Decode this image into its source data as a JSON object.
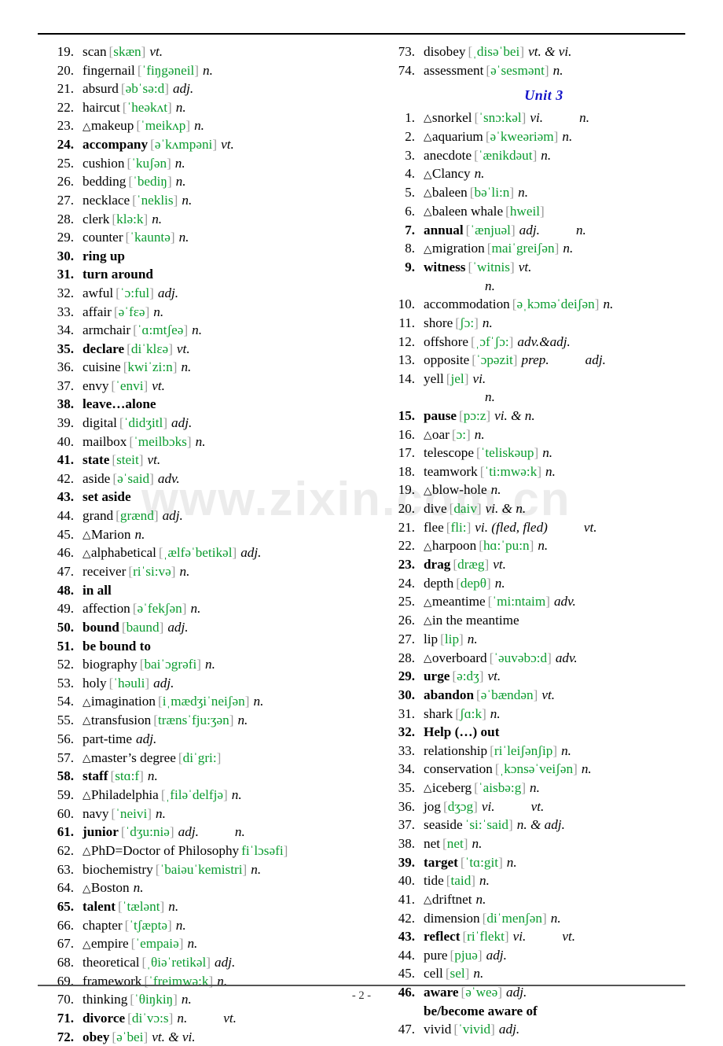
{
  "page": {
    "footer": "- 2 -",
    "watermark": "www.zixin.com.cn",
    "accent_green": "#0c9c30",
    "bracket_gray": "#9a9a9a",
    "unit_blue": "#1414c8"
  },
  "left_column": {
    "entries": [
      {
        "num": "19.",
        "word": "scan",
        "phon": "[skæn]",
        "pos": "vt.",
        "bold": false,
        "tri": false
      },
      {
        "num": "20.",
        "word": "fingernail",
        "phon": "[ˈfiŋgəneil]",
        "pos": "n.",
        "bold": false,
        "tri": false
      },
      {
        "num": "21.",
        "word": "absurd",
        "phon": "[əbˈsə:d]",
        "pos": "adj.",
        "bold": false,
        "tri": false
      },
      {
        "num": "22.",
        "word": "haircut",
        "phon": "[ˈheəkʌt]",
        "pos": "n.",
        "bold": false,
        "tri": false
      },
      {
        "num": "23.",
        "word": "makeup",
        "phon": "[ˈmeikʌp]",
        "pos": "n.",
        "bold": false,
        "tri": true
      },
      {
        "num": "24.",
        "word": "accompany",
        "phon": "[əˈkʌmpəni]",
        "pos": "vt.",
        "bold": true,
        "tri": false
      },
      {
        "num": "25.",
        "word": "cushion",
        "phon": "[ˈkuʃən]",
        "pos": "n.",
        "bold": false,
        "tri": false
      },
      {
        "num": "26.",
        "word": "bedding",
        "phon": "[ˈbediŋ]",
        "pos": "n.",
        "bold": false,
        "tri": false
      },
      {
        "num": "27.",
        "word": "necklace",
        "phon": "[ˈneklis]",
        "pos": "n.",
        "bold": false,
        "tri": false
      },
      {
        "num": "28.",
        "word": "clerk",
        "phon": "[klə:k]",
        "pos": "n.",
        "bold": false,
        "tri": false
      },
      {
        "num": "29.",
        "word": "counter",
        "phon": "[ˈkauntə]",
        "pos": "n.",
        "bold": false,
        "tri": false
      },
      {
        "num": "30.",
        "word": "ring up",
        "phon": "",
        "pos": "",
        "bold": true,
        "tri": false
      },
      {
        "num": "31.",
        "word": "turn around",
        "phon": "",
        "pos": "",
        "bold": true,
        "tri": false
      },
      {
        "num": "32.",
        "word": "awful",
        "phon": "[ˈɔ:ful]",
        "pos": "adj.",
        "bold": false,
        "tri": false
      },
      {
        "num": "33.",
        "word": "affair",
        "phon": "[əˈfɛə]",
        "pos": "n.",
        "bold": false,
        "tri": false
      },
      {
        "num": "34.",
        "word": "armchair",
        "phon": "[ˈɑ:mtʃeə]",
        "pos": "n.",
        "bold": false,
        "tri": false
      },
      {
        "num": "35.",
        "word": "declare",
        "phon": "[diˈklɛə]",
        "pos": "vt.",
        "bold": true,
        "tri": false
      },
      {
        "num": "36.",
        "word": "cuisine",
        "phon": "[kwiˈzi:n]",
        "pos": "n.",
        "bold": false,
        "tri": false
      },
      {
        "num": "37.",
        "word": "envy",
        "phon": "[ˈenvi]",
        "pos": "vt.",
        "bold": false,
        "tri": false
      },
      {
        "num": "38.",
        "word": "leave…alone",
        "phon": "",
        "pos": "",
        "bold": true,
        "tri": false
      },
      {
        "num": "39.",
        "word": "digital",
        "phon": "[ˈdidʒitl]",
        "pos": "adj.",
        "bold": false,
        "tri": false
      },
      {
        "num": "40.",
        "word": "mailbox",
        "phon": "[ˈmeilbɔks]",
        "pos": "n.",
        "bold": false,
        "tri": false
      },
      {
        "num": "41.",
        "word": "state",
        "phon": "[steit]",
        "pos": "vt.",
        "bold": true,
        "tri": false
      },
      {
        "num": "42.",
        "word": "aside",
        "phon": "[əˈsaid]",
        "pos": "adv.",
        "bold": false,
        "tri": false
      },
      {
        "num": "43.",
        "word": "set aside",
        "phon": "",
        "pos": "",
        "bold": true,
        "tri": false
      },
      {
        "num": "44.",
        "word": "grand",
        "phon": "[grænd]",
        "pos": "adj.",
        "bold": false,
        "tri": false
      },
      {
        "num": "45.",
        "word": "Marion",
        "phon": "",
        "pos": "n.",
        "bold": false,
        "tri": true
      },
      {
        "num": "46.",
        "word": "alphabetical",
        "phon": "[ˌælfəˈbetikəl]",
        "pos": "adj.",
        "bold": false,
        "tri": true
      },
      {
        "num": "47.",
        "word": "receiver",
        "phon": "[riˈsi:və]",
        "pos": "n.",
        "bold": false,
        "tri": false
      },
      {
        "num": "48.",
        "word": "in all",
        "phon": "",
        "pos": "",
        "bold": true,
        "tri": false
      },
      {
        "num": "49.",
        "word": "affection",
        "phon": "[əˈfekʃən]",
        "pos": "n.",
        "bold": false,
        "tri": false
      },
      {
        "num": "50.",
        "word": "bound",
        "phon": "[baund]",
        "pos": "adj.",
        "bold": true,
        "tri": false
      },
      {
        "num": "51.",
        "word": "be bound to",
        "phon": "",
        "pos": "",
        "bold": true,
        "tri": false
      },
      {
        "num": "52.",
        "word": "biography",
        "phon": "[baiˈɔgrəfi]",
        "pos": "n.",
        "bold": false,
        "tri": false
      },
      {
        "num": "53.",
        "word": "holy",
        "phon": "[ˈhəuli]",
        "pos": "adj.",
        "bold": false,
        "tri": false
      },
      {
        "num": "54.",
        "word": "imagination",
        "phon": "[iˌmædʒiˈneiʃən]",
        "pos": "n.",
        "bold": false,
        "tri": true
      },
      {
        "num": "55.",
        "word": "transfusion",
        "phon": "[trænsˈfju:ʒən]",
        "pos": "n.",
        "bold": false,
        "tri": true
      },
      {
        "num": "56.",
        "word": "part-time",
        "phon": "",
        "pos": "adj.",
        "bold": false,
        "tri": false
      },
      {
        "num": "57.",
        "word": "master’s degree",
        "phon": "[diˈgri:]",
        "pos": "",
        "bold": false,
        "tri": true
      },
      {
        "num": "58.",
        "word": "staff",
        "phon": "[stɑ:f]",
        "pos": "n.",
        "bold": true,
        "tri": false
      },
      {
        "num": "59.",
        "word": "Philadelphia",
        "phon": "[ˌfiləˈdelfjə]",
        "pos": "n.",
        "bold": false,
        "tri": true
      },
      {
        "num": "60.",
        "word": "navy",
        "phon": "[ˈneivi]",
        "pos": "n.",
        "bold": false,
        "tri": false
      },
      {
        "num": "61.",
        "word": "junior",
        "phon": "[ˈdʒu:niə]",
        "pos": "adj.",
        "pos2": "n.",
        "bold": true,
        "tri": false
      },
      {
        "num": "62.",
        "word": "PhD=Doctor of Philosophy",
        "phon": "fiˈlɔsəfi]",
        "pos": "",
        "bold": false,
        "tri": true
      },
      {
        "num": "63.",
        "word": "biochemistry",
        "phon": "[ˈbaiəuˈkemistri]",
        "pos": "n.",
        "bold": false,
        "tri": false
      },
      {
        "num": "64.",
        "word": "Boston",
        "phon": "",
        "pos": "n.",
        "bold": false,
        "tri": true
      },
      {
        "num": "65.",
        "word": "talent",
        "phon": "[ˈtælənt]",
        "pos": "n.",
        "bold": true,
        "tri": false
      },
      {
        "num": "66.",
        "word": "chapter",
        "phon": "[ˈtʃæptə]",
        "pos": "n.",
        "bold": false,
        "tri": false
      },
      {
        "num": "67.",
        "word": "empire",
        "phon": "[ˈempaiə]",
        "pos": "n.",
        "bold": false,
        "tri": true
      },
      {
        "num": "68.",
        "word": "theoretical",
        "phon": "[ˌθiəˈretikəl]",
        "pos": "adj.",
        "bold": false,
        "tri": false
      },
      {
        "num": "69.",
        "word": "framework",
        "phon": "[ˈfreimwə:k]",
        "pos": "n.",
        "bold": false,
        "tri": false
      },
      {
        "num": "70.",
        "word": "thinking",
        "phon": "[ˈθiŋkiŋ]",
        "pos": "n.",
        "bold": false,
        "tri": false
      },
      {
        "num": "71.",
        "word": "divorce",
        "phon": "[diˈvɔ:s]",
        "pos": "n.",
        "pos2": "vt.",
        "bold": true,
        "tri": false
      },
      {
        "num": "72.",
        "word": "obey",
        "phon": "[əˈbei]",
        "pos": "vt. & vi.",
        "bold": true,
        "tri": false
      }
    ]
  },
  "right_column": {
    "pre_entries": [
      {
        "num": "73.",
        "word": "disobey",
        "phon": "[ˌdisəˈbei]",
        "pos": "vt. & vi.",
        "bold": false,
        "tri": false
      },
      {
        "num": "74.",
        "word": "assessment",
        "phon": "[əˈsesmənt]",
        "pos": "n.",
        "bold": false,
        "tri": false
      }
    ],
    "unit_heading": "Unit 3",
    "entries": [
      {
        "num": "1.",
        "word": "snorkel",
        "phon": "[ˈsnɔ:kəl]",
        "pos": "vi.",
        "pos2": "n.",
        "bold": false,
        "tri": true
      },
      {
        "num": "2.",
        "word": "aquarium",
        "phon": "[əˈkweəriəm]",
        "pos": "n.",
        "bold": false,
        "tri": true
      },
      {
        "num": "3.",
        "word": "anecdote",
        "phon": "[ˈænikdəut]",
        "pos": "n.",
        "bold": false,
        "tri": false
      },
      {
        "num": "4.",
        "word": "Clancy",
        "phon": "",
        "pos": "n.",
        "bold": false,
        "tri": true
      },
      {
        "num": "5.",
        "word": "baleen",
        "phon": "[bəˈli:n]",
        "pos": "n.",
        "bold": false,
        "tri": true
      },
      {
        "num": "6.",
        "word": "baleen whale",
        "phon": "[hweil]",
        "pos": "",
        "bold": false,
        "tri": true
      },
      {
        "num": "7.",
        "word": "annual",
        "phon": "[ˈænjuəl]",
        "pos": "adj.",
        "pos2": "n.",
        "bold": true,
        "tri": false
      },
      {
        "num": "8.",
        "word": "migration",
        "phon": "[maiˈgreiʃən]",
        "pos": "n.",
        "bold": false,
        "tri": true
      },
      {
        "num": "9.",
        "word": "witness",
        "phon": "[ˈwitnis]",
        "pos": "vt.",
        "bold": true,
        "tri": false,
        "cont": "n."
      },
      {
        "num": "10.",
        "word": "accommodation",
        "phon": "[əˌkɔməˈdeiʃən]",
        "pos": "n.",
        "bold": false,
        "tri": false
      },
      {
        "num": "11.",
        "word": "shore",
        "phon": "[ʃɔ:]",
        "pos": "n.",
        "bold": false,
        "tri": false
      },
      {
        "num": "12.",
        "word": "offshore",
        "phon": "[ˌɔfˈʃɔ:]",
        "pos": "adv.&adj.",
        "bold": false,
        "tri": false
      },
      {
        "num": "13.",
        "word": "opposite",
        "phon": "[ˈɔpəzit]",
        "pos": "prep.",
        "pos2": "adj.",
        "bold": false,
        "tri": false
      },
      {
        "num": "14.",
        "word": "yell",
        "phon": "[jel]",
        "pos": "vi.",
        "bold": false,
        "tri": false,
        "cont": "n."
      },
      {
        "num": "15.",
        "word": "pause",
        "phon": "[pɔ:z]",
        "pos": "vi. & n.",
        "bold": true,
        "tri": false
      },
      {
        "num": "16.",
        "word": "oar",
        "phon": "[ɔ:]",
        "pos": "n.",
        "bold": false,
        "tri": true
      },
      {
        "num": "17.",
        "word": "telescope",
        "phon": "[ˈteliskəup]",
        "pos": "n.",
        "bold": false,
        "tri": false
      },
      {
        "num": "18.",
        "word": "teamwork",
        "phon": "[ˈti:mwə:k]",
        "pos": "n.",
        "bold": false,
        "tri": false
      },
      {
        "num": "19.",
        "word": "blow-hole",
        "phon": "",
        "pos": "n.",
        "bold": false,
        "tri": true
      },
      {
        "num": "20.",
        "word": "dive",
        "phon": "[daiv]",
        "pos": "vi. & n.",
        "bold": false,
        "tri": false
      },
      {
        "num": "21.",
        "word": "flee",
        "phon": "[fli:]",
        "pos": "vi. (fled, fled)",
        "pos2": "vt.",
        "bold": false,
        "tri": false
      },
      {
        "num": "22.",
        "word": "harpoon",
        "phon": "[hɑ:ˈpu:n]",
        "pos": "n.",
        "bold": false,
        "tri": true
      },
      {
        "num": "23.",
        "word": "drag",
        "phon": "[dræg]",
        "pos": "vt.",
        "bold": true,
        "tri": false
      },
      {
        "num": "24.",
        "word": "depth",
        "phon": "[depθ]",
        "pos": "n.",
        "bold": false,
        "tri": false
      },
      {
        "num": "25.",
        "word": "meantime",
        "phon": "[ˈmi:ntaim]",
        "pos": "adv.",
        "bold": false,
        "tri": true
      },
      {
        "num": "26.",
        "word": "in the meantime",
        "phon": "",
        "pos": "",
        "bold": false,
        "tri": true
      },
      {
        "num": "27.",
        "word": "lip",
        "phon": "[lip]",
        "pos": "n.",
        "bold": false,
        "tri": false
      },
      {
        "num": "28.",
        "word": "overboard",
        "phon": "[ˈəuvəbɔ:d]",
        "pos": "adv.",
        "bold": false,
        "tri": true
      },
      {
        "num": "29.",
        "word": "urge",
        "phon": "[ə:dʒ]",
        "pos": "vt.",
        "bold": true,
        "tri": false
      },
      {
        "num": "30.",
        "word": "abandon",
        "phon": "[əˈbændən]",
        "pos": "vt.",
        "bold": true,
        "tri": false
      },
      {
        "num": "31.",
        "word": "shark",
        "phon": "[ʃɑ:k]",
        "pos": "n.",
        "bold": false,
        "tri": false
      },
      {
        "num": "32.",
        "word": "Help (…) out",
        "phon": "",
        "pos": "",
        "bold": true,
        "tri": false
      },
      {
        "num": "33.",
        "word": "relationship",
        "phon": "[riˈleiʃənʃip]",
        "pos": "n.",
        "bold": false,
        "tri": false
      },
      {
        "num": "34.",
        "word": "conservation",
        "phon": "[ˌkɔnsəˈveiʃən]",
        "pos": "n.",
        "bold": false,
        "tri": false
      },
      {
        "num": "35.",
        "word": "iceberg",
        "phon": "[ˈaisbə:g]",
        "pos": "n.",
        "bold": false,
        "tri": true
      },
      {
        "num": "36.",
        "word": "jog",
        "phon": "[dʒɔg]",
        "pos": "vi.",
        "pos2": "vt.",
        "bold": false,
        "tri": false
      },
      {
        "num": "37.",
        "word": "seaside",
        "phon": "ˈsi:ˈsaid]",
        "pos": "n. & adj.",
        "bold": false,
        "tri": false
      },
      {
        "num": "38.",
        "word": "net",
        "phon": "[net]",
        "pos": "n.",
        "bold": false,
        "tri": false
      },
      {
        "num": "39.",
        "word": "target",
        "phon": "[ˈtɑ:git]",
        "pos": "n.",
        "bold": true,
        "tri": false
      },
      {
        "num": "40.",
        "word": "tide",
        "phon": "[taid]",
        "pos": "n.",
        "bold": false,
        "tri": false
      },
      {
        "num": "41.",
        "word": "driftnet",
        "phon": "",
        "pos": "n.",
        "bold": false,
        "tri": true
      },
      {
        "num": "42.",
        "word": "dimension",
        "phon": "[diˈmenʃən]",
        "pos": "n.",
        "bold": false,
        "tri": false
      },
      {
        "num": "43.",
        "word": "reflect",
        "phon": "[riˈflekt]",
        "pos": "vi.",
        "pos2": "vt.",
        "bold": true,
        "tri": false
      },
      {
        "num": "44.",
        "word": "pure",
        "phon": "[pjuə]",
        "pos": "adj.",
        "bold": false,
        "tri": false
      },
      {
        "num": "45.",
        "word": "cell",
        "phon": "[sel]",
        "pos": "n.",
        "bold": false,
        "tri": false
      },
      {
        "num": "46.",
        "word": "aware",
        "phon": "[əˈweə]",
        "pos": "adj.",
        "bold": true,
        "tri": false,
        "subline": "be/become aware of"
      },
      {
        "num": "47.",
        "word": "vivid",
        "phon": "[ˈvivid]",
        "pos": "adj.",
        "bold": false,
        "tri": false
      }
    ]
  }
}
